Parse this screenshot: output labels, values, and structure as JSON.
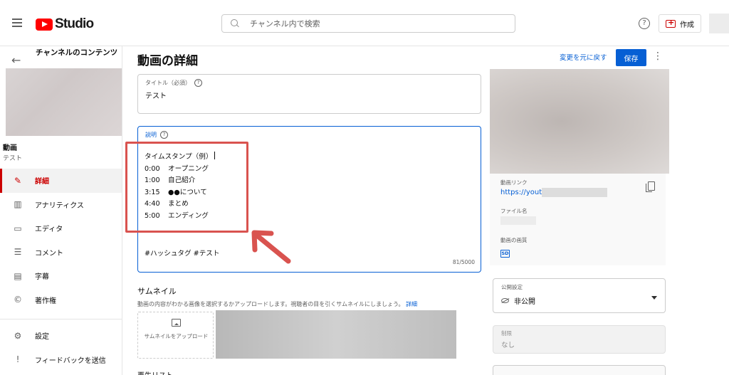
{
  "topbar": {
    "logo_text": "Studio",
    "search_placeholder": "チャンネル内で検索",
    "help_label": "?",
    "create_label": "作成",
    "brand_color": "#ff0000"
  },
  "sidebar": {
    "channel_title": "チャンネルのコンテンツ",
    "video_label": "動画",
    "video_sub": "テスト",
    "items": [
      {
        "label": "詳細",
        "icon": "pencil-icon",
        "glyph": "✎",
        "active": true
      },
      {
        "label": "アナリティクス",
        "icon": "analytics-icon",
        "glyph": "▥",
        "active": false
      },
      {
        "label": "エディタ",
        "icon": "editor-icon",
        "glyph": "▭",
        "active": false
      },
      {
        "label": "コメント",
        "icon": "comment-icon",
        "glyph": "☰",
        "active": false
      },
      {
        "label": "字幕",
        "icon": "subtitles-icon",
        "glyph": "▤",
        "active": false
      },
      {
        "label": "著作権",
        "icon": "copyright-icon",
        "glyph": "©",
        "active": false
      }
    ],
    "bottom_items": [
      {
        "label": "設定",
        "icon": "settings-icon",
        "glyph": "⚙"
      },
      {
        "label": "フィードバックを送信",
        "icon": "feedback-icon",
        "glyph": "!"
      }
    ]
  },
  "main": {
    "page_title": "動画の詳細",
    "undo_label": "変更を元に戻す",
    "save_label": "保存",
    "more_label": "⋮",
    "title_field": {
      "label": "タイトル（必須）",
      "value": "テスト"
    },
    "description_field": {
      "label": "説明",
      "heading": "タイムスタンプ（例）",
      "lines": [
        {
          "time": "0:00",
          "text": "オープニング"
        },
        {
          "time": "1:00",
          "text": "自己紹介"
        },
        {
          "time": "3:15",
          "text": "●●について"
        },
        {
          "time": "4:40",
          "text": "まとめ"
        },
        {
          "time": "5:00",
          "text": "エンディング"
        }
      ],
      "hashtags": "#ハッシュタグ #テスト",
      "counter": "81/5000"
    },
    "thumbnail": {
      "title": "サムネイル",
      "description": "動画の内容がわかる画像を選択するかアップロードします。視聴者の目を引くサムネイルにしましょう。",
      "link": "詳細",
      "upload_label": "サムネイルをアップロード"
    },
    "playlist_title": "再生リスト"
  },
  "right_panel": {
    "video_link_label": "動画リンク",
    "video_link": "https://youtu",
    "file_name_label": "ファイル名",
    "quality_label": "動画の画質",
    "quality_badge": "SD",
    "visibility": {
      "label": "公開設定",
      "value": "非公開"
    },
    "restriction": {
      "label": "制限",
      "value": "なし"
    }
  },
  "annotation_color": "#d9534f",
  "accent_color": "#065fd4"
}
